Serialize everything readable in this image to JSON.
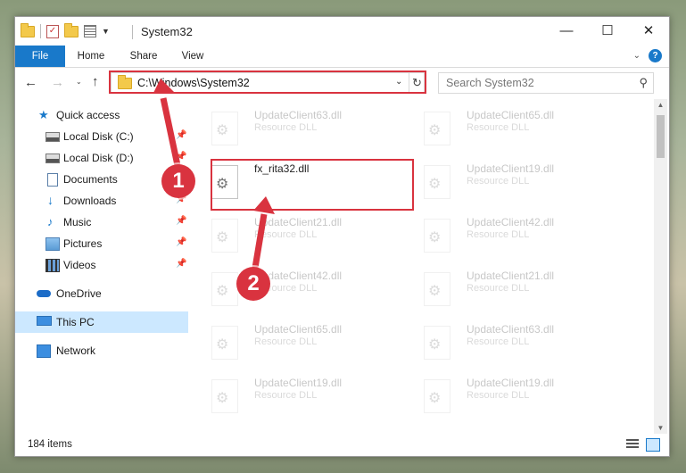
{
  "window": {
    "title": "System32",
    "minimize_glyph": "—",
    "maximize_glyph": "☐",
    "close_glyph": "✕"
  },
  "quick_access_toolbar": {
    "icons": [
      "folder-icon",
      "properties-check-icon",
      "new-folder-icon",
      "properties-icon",
      "customize-dropdown-icon"
    ]
  },
  "ribbon": {
    "tabs": [
      "File",
      "Home",
      "Share",
      "View"
    ],
    "active_tab": "File",
    "accent": "#1979ca",
    "expand_glyph": "⌄",
    "help_glyph": "?"
  },
  "navigation": {
    "back_glyph": "←",
    "forward_glyph": "→",
    "recent_glyph": "⌄",
    "up_glyph": "↑",
    "address": "C:\\Windows\\System32",
    "address_drop_glyph": "⌄",
    "refresh_glyph": "↻",
    "search_placeholder": "Search System32",
    "search_glyph": "⚲"
  },
  "nav_pane": {
    "items": [
      {
        "label": "Quick access",
        "icon": "star-icon"
      },
      {
        "label": "Local Disk (C:)",
        "icon": "drive-icon",
        "pinned": true
      },
      {
        "label": "Local Disk (D:)",
        "icon": "drive-icon",
        "pinned": true
      },
      {
        "label": "Documents",
        "icon": "documents-icon",
        "pinned": true
      },
      {
        "label": "Downloads",
        "icon": "downloads-icon",
        "pinned": true
      },
      {
        "label": "Music",
        "icon": "music-icon",
        "pinned": true
      },
      {
        "label": "Pictures",
        "icon": "pictures-icon",
        "pinned": true
      },
      {
        "label": "Videos",
        "icon": "videos-icon",
        "pinned": true
      },
      {
        "label": "OneDrive",
        "icon": "onedrive-icon"
      },
      {
        "label": "This PC",
        "icon": "this-pc-icon",
        "selected": true
      },
      {
        "label": "Network",
        "icon": "network-icon"
      }
    ],
    "pin_glyph": "📌",
    "selected_bg": "#cce8ff"
  },
  "files": {
    "left_column": [
      {
        "name": "UpdateClient63.dll",
        "type": "Resource DLL",
        "faded": true
      },
      {
        "name": "fx_rita32.dll",
        "type": "",
        "faded": false,
        "highlighted": true
      },
      {
        "name": "UpdateClient21.dll",
        "type": "Resource DLL",
        "faded": true
      },
      {
        "name": "UpdateClient42.dll",
        "type": "Resource DLL",
        "faded": true
      },
      {
        "name": "UpdateClient65.dll",
        "type": "Resource DLL",
        "faded": true
      },
      {
        "name": "UpdateClient19.dll",
        "type": "Resource DLL",
        "faded": true
      }
    ],
    "right_column": [
      {
        "name": "UpdateClient65.dll",
        "type": "Resource DLL",
        "faded": true
      },
      {
        "name": "UpdateClient19.dll",
        "type": "Resource DLL",
        "faded": true
      },
      {
        "name": "UpdateClient42.dll",
        "type": "Resource DLL",
        "faded": true
      },
      {
        "name": "UpdateClient21.dll",
        "type": "Resource DLL",
        "faded": true
      },
      {
        "name": "UpdateClient63.dll",
        "type": "Resource DLL",
        "faded": true
      },
      {
        "name": "UpdateClient19.dll",
        "type": "Resource DLL",
        "faded": true
      }
    ]
  },
  "status_bar": {
    "item_count": "184 items"
  },
  "annotations": {
    "callout_1": "1",
    "callout_2": "2",
    "highlight_color": "#d9333f"
  }
}
